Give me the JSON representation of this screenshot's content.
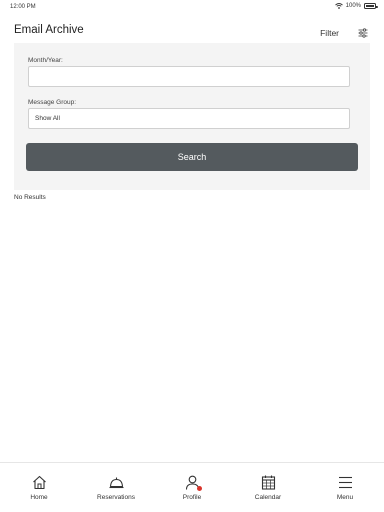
{
  "status_bar": {
    "time": "12:00 PM",
    "battery": "100%",
    "battery_level": 1.0
  },
  "header": {
    "title": "Email Archive",
    "filter_label": "Filter",
    "filter_icon": "sliders-icon"
  },
  "filter_form": {
    "month_year_label": "Month/Year:",
    "month_year_value": "",
    "message_group_label": "Message Group:",
    "message_group_value": "Show All",
    "search_label": "Search"
  },
  "results": {
    "empty_text": "No Results"
  },
  "bottom_nav": {
    "items": [
      {
        "label": "Home",
        "icon": "home-icon"
      },
      {
        "label": "Reservations",
        "icon": "bell-icon"
      },
      {
        "label": "Profile",
        "icon": "person-icon"
      },
      {
        "label": "Calendar",
        "icon": "calendar-icon"
      },
      {
        "label": "Menu",
        "icon": "menu-icon"
      }
    ]
  },
  "colors": {
    "button_bg": "#545a5e",
    "panel_bg": "#f4f4f4",
    "badge": "#d9342b"
  }
}
